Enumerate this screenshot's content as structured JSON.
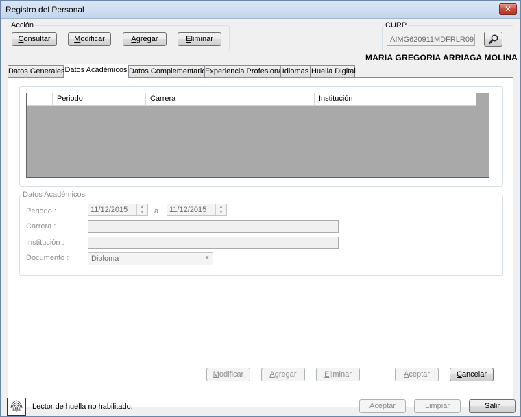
{
  "window": {
    "title": "Registro del Personal",
    "close_glyph": "✕"
  },
  "accion": {
    "legend": "Acción",
    "consultar": {
      "u": "C",
      "rest": "onsultar"
    },
    "modificar": {
      "u": "M",
      "rest": "odificar"
    },
    "agregar": {
      "u": "A",
      "rest": "gregar"
    },
    "eliminar": {
      "u": "E",
      "rest": "liminar"
    }
  },
  "curp": {
    "legend": "CURP",
    "value": "AIMG620911MDFRLR09",
    "search_icon": "magnifier-icon"
  },
  "person_name": "MARIA GREGORIA ARRIAGA MOLINA",
  "tabs": [
    {
      "label": "Datos Generales",
      "active": false
    },
    {
      "label": "Datos Académicos",
      "active": true
    },
    {
      "label": "Datos Complementarios",
      "active": false
    },
    {
      "label": "Experiencia Profesional",
      "active": false
    },
    {
      "label": "Idiomas",
      "active": false
    },
    {
      "label": "Huella Digital",
      "active": false
    }
  ],
  "grid": {
    "columns": [
      "",
      "Periodo",
      "Carrera",
      "Institución"
    ],
    "rows": []
  },
  "form": {
    "legend": "Datos Académicos",
    "periodo_label": "Periodo :",
    "fecha_desde": "11/12/2015",
    "a_label": "a",
    "fecha_hasta": "11/12/2015",
    "carrera_label": "Carrera :",
    "carrera_value": "",
    "institucion_label": "Institución :",
    "institucion_value": "",
    "documento_label": "Documento :",
    "documento_value": "Diploma"
  },
  "tab_buttons": {
    "modificar": {
      "u": "M",
      "rest": "odificar"
    },
    "agregar": {
      "u": "A",
      "rest": "gregar"
    },
    "eliminar": {
      "u": "E",
      "rest": "liminar"
    },
    "aceptar": {
      "u": "A",
      "rest": "ceptar"
    },
    "cancelar": {
      "u": "C",
      "rest": "ancelar"
    }
  },
  "footer": {
    "status": "Lector de huella no habilitado.",
    "aceptar": {
      "u": "A",
      "rest": "ceptar"
    },
    "limpiar": {
      "u": "L",
      "rest": "impiar"
    },
    "salir": {
      "u": "S",
      "rest": "alir"
    }
  },
  "colors": {
    "grid_bg": "#a9a9a9",
    "title_gradient_top": "#dbe7f5",
    "close_red": "#c74a36"
  }
}
